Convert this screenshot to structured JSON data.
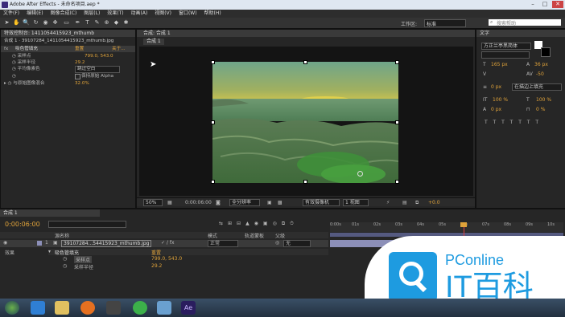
{
  "window": {
    "title": "Adobe After Effects - 未命名项目.aep *"
  },
  "menu": [
    "文件(F)",
    "编辑(E)",
    "图像合成(C)",
    "图层(L)",
    "效果(T)",
    "动画(A)",
    "视图(V)",
    "窗口(W)",
    "帮助(H)"
  ],
  "toolbar": {
    "workspace_label": "工作区:",
    "workspace_value": "标准",
    "search_placeholder": "搜索帮助"
  },
  "effects_panel": {
    "tab": "特效控制台: 1411054415923_mthumb",
    "subtitle": "合成 1 · 39107284_1411054415923_mthumb.jpg",
    "effect_name": "吸色管填充",
    "reset": "重置",
    "about": "关于...",
    "props": [
      {
        "label": "采样点",
        "value": "799.0, 543.0"
      },
      {
        "label": "采样半径",
        "value": "29.2"
      },
      {
        "label": "平均像素色",
        "value": "跳过空白"
      },
      {
        "label": "",
        "value": "保持原始 Alpha"
      },
      {
        "label": "与原始图像混合",
        "value": "32.0%"
      }
    ]
  },
  "composition": {
    "tab": "合成: 合成 1",
    "subtab": "合成 1"
  },
  "viewer_bar": {
    "zoom": "50%",
    "time": "0:00:06:00",
    "resolution": "全分辨率",
    "camera": "有效摄像机",
    "views": "1 视图",
    "offset": "+0.0"
  },
  "character_panel": {
    "tab": "文字",
    "font": "方正兰亭黑简体",
    "size": "165 px",
    "leading": "36 px",
    "tracking": "-50",
    "stroke": "0 px",
    "stroke_type": "在描边上填充",
    "scale_v": "100 %",
    "scale_h": "100 %",
    "baseline": "0 px",
    "tsume": "0 %"
  },
  "timeline": {
    "tab": "合成 1",
    "timecode": "0:00:06:00",
    "col_layer": "源名称",
    "col_mode": "模式",
    "col_trkmat": "轨道蒙板",
    "col_parent": "父级",
    "layer": {
      "index": "1",
      "name": "39107284...54415923_mthumb.jpg",
      "mode": "正常",
      "parent": "无"
    },
    "effects_label": "效果",
    "effect_name": "吸色管填充",
    "reset": "重置",
    "props": [
      {
        "label": "采样点",
        "value": "799.0, 543.0"
      },
      {
        "label": "采样半径",
        "value": "29.2"
      }
    ],
    "ruler": [
      "0:00s",
      "01s",
      "02s",
      "03s",
      "04s",
      "05s",
      "06s",
      "07s",
      "08s",
      "09s",
      "10s"
    ]
  },
  "watermark": {
    "brand": "PConline",
    "name": "IT百科"
  },
  "colors": {
    "accent_orange": "#e0a33a",
    "selection_blue": "#6aa0e0",
    "layer_bar": "#8c8fb8",
    "watermark_blue": "#1e9be0"
  }
}
